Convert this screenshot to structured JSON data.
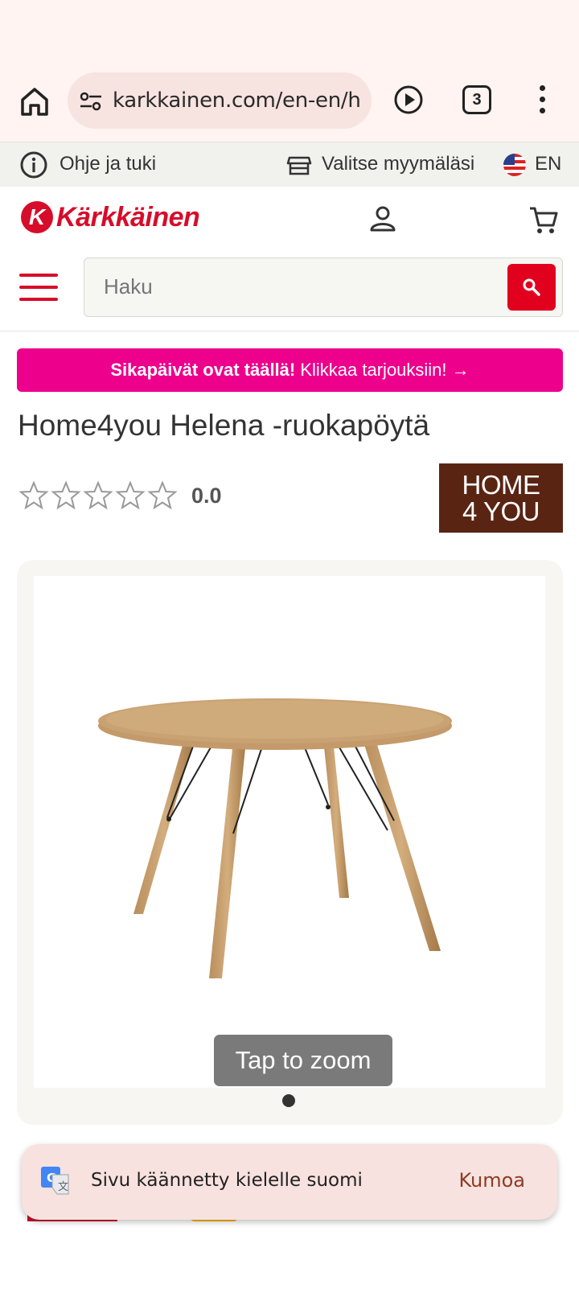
{
  "browser": {
    "url": "karkkainen.com/en-en/h",
    "tab_count": "3"
  },
  "help_bar": {
    "help_label": "Ohje ja tuki",
    "store_label": "Valitse myymäläsi",
    "language": "EN"
  },
  "header": {
    "logo_mark": "K",
    "logo_text": "Kärkkäinen",
    "search_placeholder": "Haku"
  },
  "promo": {
    "bold": "Sikapäivät ovat täällä!",
    "link": " Klikkaa tarjouksiin! →"
  },
  "product": {
    "title": "Home4you Helena -ruokapöytä",
    "rating_value": "0.0",
    "rating_stars": 0,
    "rating_max": 5,
    "brand_line1": "HOME",
    "brand_line2": "4 YOU",
    "zoom_label": "Tap to zoom",
    "image_count": 1
  },
  "toast": {
    "message": "Sivu käännetty kielelle suomi",
    "action": "Kumoa"
  },
  "colors": {
    "brand_red": "#e1001e",
    "promo_pink": "#ec008c",
    "brand_logo_bg": "#5a2413"
  }
}
